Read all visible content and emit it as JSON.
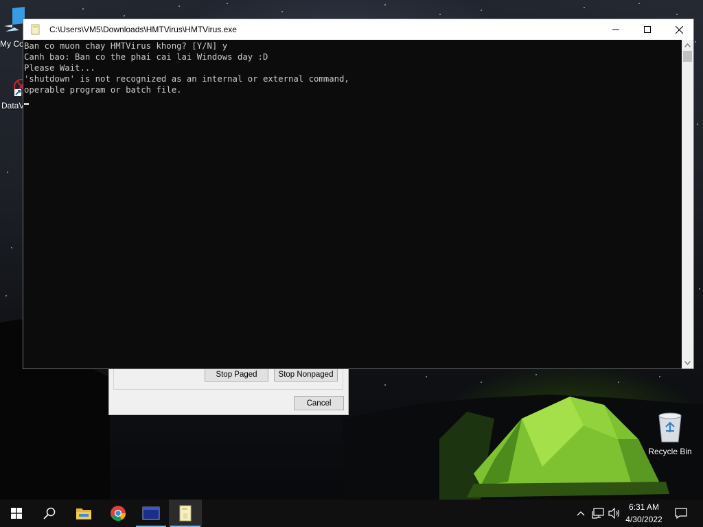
{
  "desktop": {
    "icons": [
      {
        "label": "My Co",
        "icon": "computer-icon"
      },
      {
        "label": "DataV",
        "icon": "datavault-icon"
      },
      {
        "label": "Recycle Bin",
        "icon": "recycle-bin-icon"
      }
    ]
  },
  "background_dialog": {
    "stop_paged_label": "Stop Paged",
    "stop_nonpaged_label": "Stop Nonpaged",
    "cancel_label": "Cancel"
  },
  "console": {
    "title": "C:\\Users\\VM5\\Downloads\\HMTVirus\\HMTVirus.exe",
    "lines": [
      "Ban co muon chay HMTVirus khong? [Y/N] y",
      "Canh bao: Ban co the phai cai lai Windows day :D",
      "Please Wait...",
      "'shutdown' is not recognized as an internal or external command,",
      "operable program or batch file."
    ],
    "controls": [
      "minimize-icon",
      "maximize-icon",
      "close-icon"
    ]
  },
  "taskbar": {
    "buttons": [
      "windows-start-icon",
      "search-icon",
      "file-explorer-icon",
      "chrome-icon",
      "app-window-icon",
      "hmtvirus-icon"
    ],
    "tray_icons": [
      "chevron-up-icon",
      "network-icon",
      "volume-icon"
    ],
    "time": "6:31 AM",
    "date": "4/30/2022",
    "notification_icon": "notification-icon"
  },
  "colors": {
    "console_bg": "#0c0c0c",
    "console_text": "#cccccc",
    "taskbar_bg": "#101010",
    "active_underline": "#76b9ed"
  }
}
